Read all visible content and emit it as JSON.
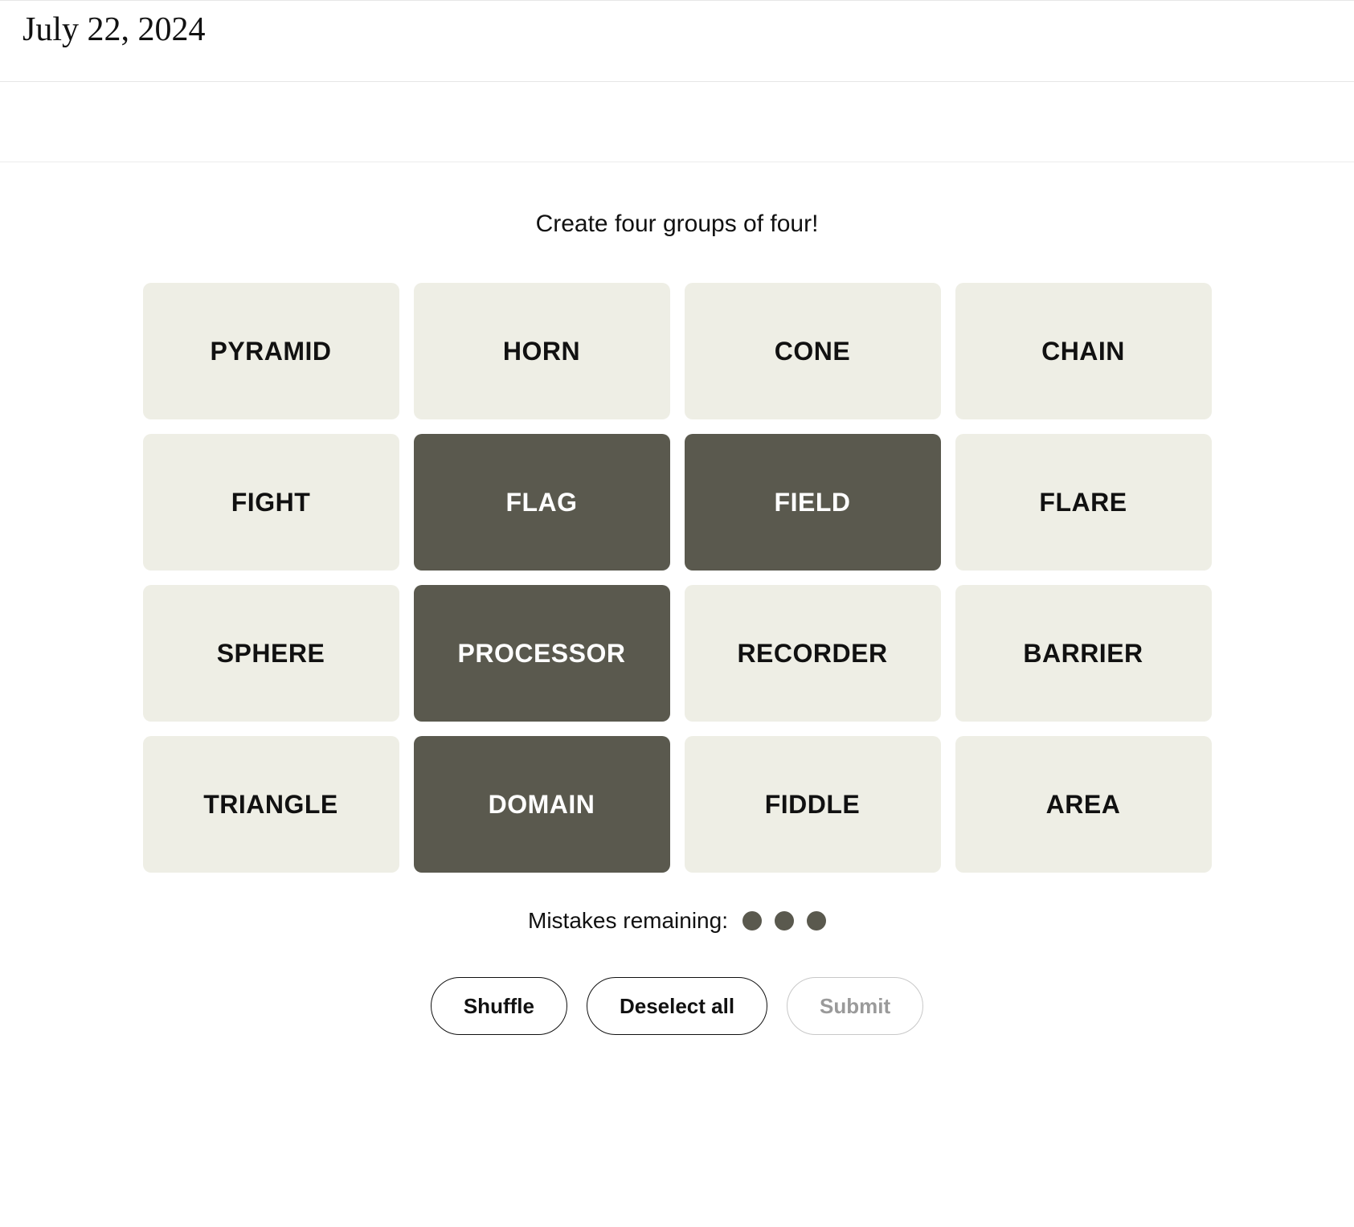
{
  "date": "July 22, 2024",
  "instruction": "Create four groups of four!",
  "tiles": [
    {
      "label": "PYRAMID",
      "selected": false
    },
    {
      "label": "HORN",
      "selected": false
    },
    {
      "label": "CONE",
      "selected": false
    },
    {
      "label": "CHAIN",
      "selected": false
    },
    {
      "label": "FIGHT",
      "selected": false
    },
    {
      "label": "FLAG",
      "selected": true
    },
    {
      "label": "FIELD",
      "selected": true
    },
    {
      "label": "FLARE",
      "selected": false
    },
    {
      "label": "SPHERE",
      "selected": false
    },
    {
      "label": "PROCESSOR",
      "selected": true
    },
    {
      "label": "RECORDER",
      "selected": false
    },
    {
      "label": "BARRIER",
      "selected": false
    },
    {
      "label": "TRIANGLE",
      "selected": false
    },
    {
      "label": "DOMAIN",
      "selected": true
    },
    {
      "label": "FIDDLE",
      "selected": false
    },
    {
      "label": "AREA",
      "selected": false
    }
  ],
  "mistakes": {
    "label": "Mistakes remaining:",
    "remaining": 3
  },
  "buttons": {
    "shuffle": "Shuffle",
    "deselect": "Deselect all",
    "submit": "Submit",
    "submit_enabled": false
  }
}
